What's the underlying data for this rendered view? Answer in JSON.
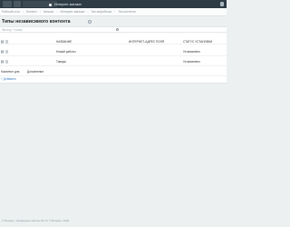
{
  "topbar": {
    "active_label": "Интернет-магазин"
  },
  "breadcrumb": [
    "Рабочий стол",
    "Контент",
    "Каталог",
    "Интернет-магазин",
    "Тип инфоблока",
    "Тип контента"
  ],
  "page": {
    "title": "Типы независимого контента"
  },
  "search": {
    "placeholder": "Фильтр + поиск"
  },
  "table": {
    "columns": {
      "name": "НАЗВАНИЕ",
      "url": "ИНТЕРНЕТ-АДРЕС ПОЛЯ",
      "status": "СТАТУС УСТАНОВКИ"
    },
    "rows": [
      {
        "name": "Новый работы",
        "status": "Установлено"
      },
      {
        "name": "Товары",
        "status": "Установлено"
      }
    ],
    "combo_row": {
      "label": "Комплект для",
      "value": "Дополнение"
    },
    "add_label": "+ Добавить"
  },
  "footer": {
    "text": "© Битрикс. Управление сайтом 18.1.8. © Битрикс, 2018"
  }
}
